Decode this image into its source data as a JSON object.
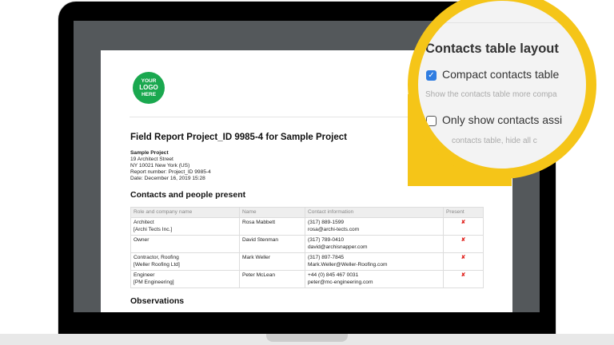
{
  "logo": {
    "line1": "YOUR",
    "line2": "LOGO",
    "line3": "HERE"
  },
  "report": {
    "title": "Field Report Project_ID 9985-4 for Sample Project",
    "project_name": "Sample Project",
    "address1": "19 Architect Street",
    "address2": "NY 10021 New York (US)",
    "report_number": "Report number: Project_ID 9985-4",
    "date": "Date: December 16, 2019 15:28",
    "contacts_heading": "Contacts and people present",
    "observations_heading": "Observations"
  },
  "contacts": {
    "headers": [
      "Role and company name",
      "Name",
      "Contact information",
      "Present"
    ],
    "rows": [
      {
        "role": "Architect",
        "company": "[Archi Tects Inc.]",
        "name": "Rosa Mabbett",
        "phone": "(317) 889-1599",
        "email": "rosa@archi-tects.com",
        "present": "✘"
      },
      {
        "role": "Owner",
        "company": "",
        "name": "David Stenman",
        "phone": "(317) 789-0410",
        "email": "david@archisnapper.com",
        "present": "✘"
      },
      {
        "role": "Contractor, Roofing",
        "company": "[Weller Roofing Ltd]",
        "name": "Mark Weller",
        "phone": "(317) 897-7845",
        "email": "Mark.Weller@Weller-Roofing.com",
        "present": "✘"
      },
      {
        "role": "Engineer",
        "company": "[PM Engineering]",
        "name": "Peter McLean",
        "phone": "+44 (0) 845 467 0031",
        "email": "peter@mc-engineering.com",
        "present": "✘"
      }
    ]
  },
  "magnifier": {
    "heading": "Contacts table layout",
    "option1_label": "Compact contacts table",
    "option1_checked": true,
    "option1_desc": "Show the contacts table more compa",
    "option2_label": "Only show contacts assi",
    "option2_checked": false,
    "option2_desc": "contacts table, hide all c",
    "accent": "#f5c518",
    "checkbox_color": "#2f7de1"
  }
}
